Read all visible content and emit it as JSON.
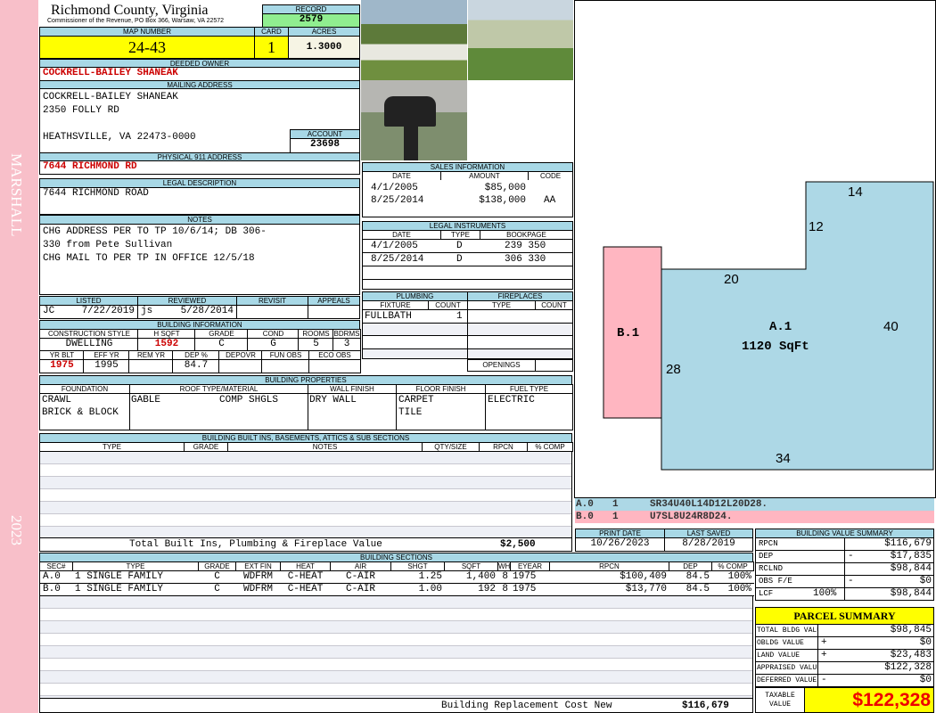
{
  "sidebar": {
    "district": "MARSHALL",
    "year": "2023"
  },
  "header": {
    "title": "Richmond County, Virginia",
    "subtitle": "Commissioner of the Revenue, PO Box 366, Warsaw, VA 22572",
    "record_label": "RECORD",
    "record": "2579"
  },
  "parcel": {
    "map_label": "MAP NUMBER",
    "map": "24-43",
    "card_label": "CARD",
    "card": "1",
    "acres_label": "ACRES",
    "acres": "1.3000"
  },
  "owner": {
    "label": "DEEDED OWNER",
    "name": "COCKRELL-BAILEY SHANEAK"
  },
  "mailing": {
    "label": "MAILING ADDRESS",
    "line1": "COCKRELL-BAILEY SHANEAK",
    "line2": "2350 FOLLY RD",
    "line3": "HEATHSVILLE, VA 22473-0000",
    "account_label": "ACCOUNT",
    "account": "23698"
  },
  "physical": {
    "label": "PHYSICAL 911 ADDRESS",
    "address": "7644 RICHMOND RD"
  },
  "legal": {
    "label": "LEGAL DESCRIPTION",
    "text": "7644 RICHMOND ROAD"
  },
  "notes": {
    "label": "NOTES",
    "lines": [
      "CHG ADDRESS PER TO TP 10/6/14; DB 306-",
      "330 from Pete Sullivan",
      "CHG MAIL TO PER TP IN OFFICE 12/5/18"
    ]
  },
  "sales": {
    "label": "SALES INFORMATION",
    "cols": [
      "DATE",
      "AMOUNT",
      "CODE"
    ],
    "rows": [
      [
        "4/1/2005",
        "$85,000",
        ""
      ],
      [
        "8/25/2014",
        "$138,000",
        "AA"
      ]
    ]
  },
  "instruments": {
    "label": "LEGAL INSTRUMENTS",
    "cols": [
      "DATE",
      "TYPE",
      "BOOKPAGE"
    ],
    "rows": [
      [
        "4/1/2005",
        "D",
        "239 350"
      ],
      [
        "8/25/2014",
        "D",
        "306 330"
      ]
    ]
  },
  "review": {
    "listed_label": "LISTED",
    "listed_by": "JC",
    "listed": "7/22/2019",
    "reviewed_label": "REVIEWED",
    "reviewed_by": "js",
    "reviewed": "5/28/2014",
    "revisit_label": "REVISIT",
    "appeals_label": "APPEALS"
  },
  "building": {
    "label": "BUILDING INFORMATION",
    "cols1": [
      "CONSTRUCTION STYLE",
      "H SQFT",
      "GRADE",
      "COND",
      "ROOMS",
      "BDRMS"
    ],
    "vals1": [
      "DWELLING",
      "1592",
      "C",
      "G",
      "5",
      "3"
    ],
    "cols2": [
      "YR BLT",
      "EFF YR",
      "REM YR",
      "DEP %",
      "DEPOVR",
      "FUN OBS",
      "ECO OBS"
    ],
    "vals2": [
      "1975",
      "1995",
      "",
      "84.7",
      "",
      "",
      ""
    ]
  },
  "plumbing": {
    "label": "PLUMBING",
    "cols": [
      "FIXTURE",
      "COUNT"
    ],
    "fixture": "FULLBATH",
    "count": "1"
  },
  "fireplaces": {
    "label": "FIREPLACES",
    "cols": [
      "TYPE",
      "COUNT"
    ],
    "openings_label": "OPENINGS"
  },
  "properties": {
    "label": "BUILDING PROPERTIES",
    "cols": [
      "FOUNDATION",
      "ROOF TYPE/MATERIAL",
      "WALL FINISH",
      "FLOOR FINISH",
      "FUEL TYPE"
    ],
    "foundation": [
      "CRAWL",
      "BRICK & BLOCK"
    ],
    "roof_type": "GABLE",
    "roof_material": "COMP SHGLS",
    "wall": "DRY WALL",
    "floor": [
      "CARPET",
      "TILE"
    ],
    "fuel": "ELECTRIC"
  },
  "builtins": {
    "label": "BUILDING BUILT INS, BASEMENTS, ATTICS & SUB SECTIONS",
    "cols": [
      "TYPE",
      "GRADE",
      "NOTES",
      "QTY/SIZE",
      "RPCN",
      "% COMP"
    ],
    "total_label": "Total Built Ins, Plumbing & Fireplace Value",
    "total": "$2,500"
  },
  "dates": {
    "print_label": "PRINT DATE",
    "print": "10/26/2023",
    "saved_label": "LAST SAVED",
    "saved": "8/28/2019"
  },
  "sections": {
    "label": "BUILDING SECTIONS",
    "cols": [
      "SEC#",
      "TYPE",
      "GRADE",
      "EXT FIN",
      "HEAT",
      "AIR",
      "SHGT",
      "SQFT",
      "WHGT",
      "EYEAR",
      "RPCN",
      "DEP",
      "% COMP"
    ],
    "rows": [
      [
        "A.0",
        "1 SINGLE FAMILY",
        "C",
        "WDFRM",
        "C-HEAT",
        "C-AIR",
        "1.25",
        "1,400",
        "8",
        "1975",
        "$100,409",
        "84.5",
        "100%"
      ],
      [
        "B.0",
        "1 SINGLE FAMILY",
        "C",
        "WDFRM",
        "C-HEAT",
        "C-AIR",
        "1.00",
        "192",
        "8",
        "1975",
        "$13,770",
        "84.5",
        "100%"
      ]
    ],
    "replacement_label": "Building Replacement Cost New",
    "replacement": "$116,679"
  },
  "sketch": {
    "a_label": "A.1",
    "a_area": "1120 SqFt",
    "b_label": "B.1",
    "dims": [
      "14",
      "12",
      "20",
      "40",
      "28",
      "34"
    ],
    "lines": [
      {
        "sec": "A.0",
        "n": "1",
        "code": "SR34U40L14D12L20D28."
      },
      {
        "sec": "B.0",
        "n": "1",
        "code": "U7SL8U24R8D24."
      }
    ],
    "colors": {
      "a": "#add8e6",
      "b": "#ffb6c1"
    }
  },
  "value_summary": {
    "label": "BUILDING VALUE SUMMARY",
    "rows": [
      {
        "k": "RPCN",
        "s": "",
        "v": "$116,679"
      },
      {
        "k": "DEP",
        "s": "-",
        "v": "$17,835"
      },
      {
        "k": "RCLND",
        "s": "",
        "v": "$98,844"
      },
      {
        "k": "OBS F/E",
        "s": "-",
        "v": "$0"
      },
      {
        "k": "LCF",
        "p": "100%",
        "s": "",
        "v": "$98,844"
      }
    ]
  },
  "parcel_summary": {
    "label": "PARCEL SUMMARY",
    "rows": [
      {
        "k": "TOTAL BLDG VALUE",
        "s": "",
        "v": "$98,845"
      },
      {
        "k": "OBLDG VALUE",
        "s": "+",
        "v": "$0"
      },
      {
        "k": "LAND VALUE",
        "s": "+",
        "v": "$23,483"
      },
      {
        "k": "APPRAISED VALUE",
        "s": "",
        "v": "$122,328"
      },
      {
        "k": "DEFERRED VALUE",
        "s": "-",
        "v": "$0"
      }
    ],
    "taxable_label": "TAXABLE VALUE",
    "taxable": "$122,328"
  }
}
